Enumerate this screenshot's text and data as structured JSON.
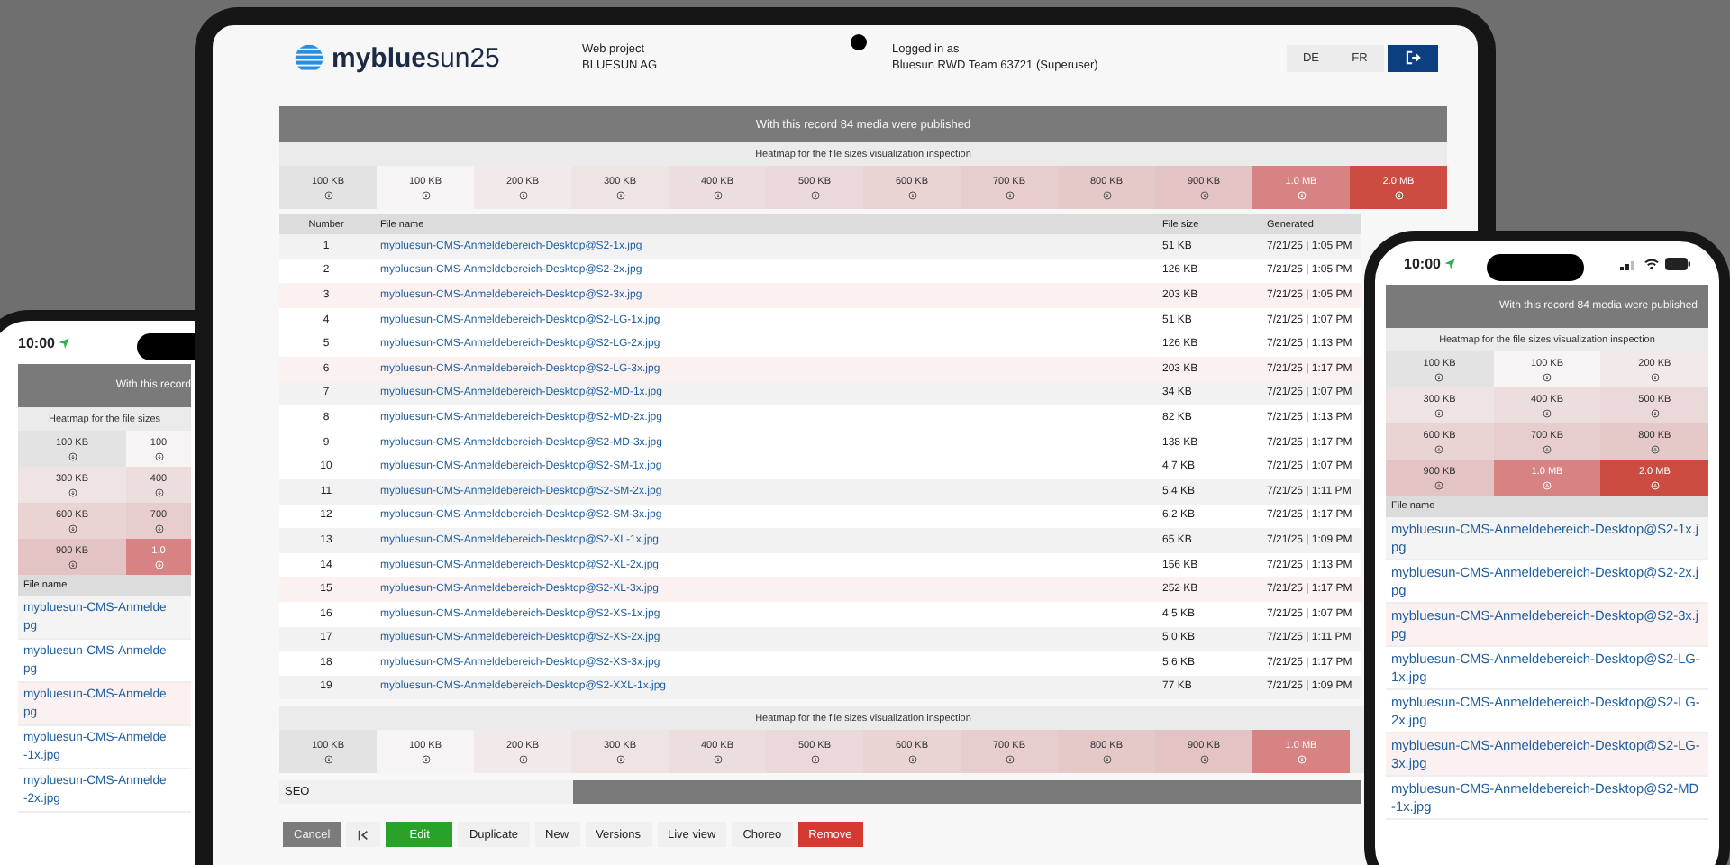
{
  "tablet": {
    "header": {
      "logo": "**myblue**sun25",
      "project_label": "Web project",
      "project": "BLUESUN AG",
      "login_label": "Logged in as",
      "login": "Bluesun RWD Team 63721 (Superuser)",
      "languages": [
        "DE",
        "FR"
      ]
    },
    "banner": "With this record 84 media were published",
    "heatmap": {
      "title": "Heatmap for the file sizes visualization inspection",
      "cells": [
        {
          "label": "100 KB",
          "color": "#e3e3e3"
        },
        {
          "label": "100 KB",
          "color": "#f6f4f4"
        },
        {
          "label": "200 KB",
          "color": "#f2eaea"
        },
        {
          "label": "300 KB",
          "color": "#efe4e4"
        },
        {
          "label": "400 KB",
          "color": "#eddede"
        },
        {
          "label": "500 KB",
          "color": "#ebd9d9"
        },
        {
          "label": "600 KB",
          "color": "#e9d3d3"
        },
        {
          "label": "700 KB",
          "color": "#e7cdcd"
        },
        {
          "label": "800 KB",
          "color": "#e5c8c8"
        },
        {
          "label": "900 KB",
          "color": "#e3c3c3"
        },
        {
          "label": "1.0 MB",
          "color": "#d88383"
        },
        {
          "label": "2.0 MB",
          "color": "#cc4c42"
        }
      ]
    },
    "table": {
      "columns": [
        "Number",
        "File name",
        "File size",
        "Generated"
      ],
      "rows": [
        {
          "number": "1",
          "file": "mybluesun-CMS-Anmeldebereich-Desktop@S2-1x.jpg",
          "size": "51 KB",
          "generated": "7/21/25 | 1:05 PM",
          "color": "#f2f2f2"
        },
        {
          "number": "2",
          "file": "mybluesun-CMS-Anmeldebereich-Desktop@S2-2x.jpg",
          "size": "126 KB",
          "generated": "7/21/25 | 1:05 PM",
          "color": "#ffffff"
        },
        {
          "number": "3",
          "file": "mybluesun-CMS-Anmeldebereich-Desktop@S2-3x.jpg",
          "size": "203 KB",
          "generated": "7/21/25 | 1:05 PM",
          "color": "#fcf1f1"
        },
        {
          "number": "4",
          "file": "mybluesun-CMS-Anmeldebereich-Desktop@S2-LG-1x.jpg",
          "size": "51 KB",
          "generated": "7/21/25 | 1:07 PM",
          "color": "#ffffff"
        },
        {
          "number": "5",
          "file": "mybluesun-CMS-Anmeldebereich-Desktop@S2-LG-2x.jpg",
          "size": "126 KB",
          "generated": "7/21/25 | 1:13 PM",
          "color": "#ffffff"
        },
        {
          "number": "6",
          "file": "mybluesun-CMS-Anmeldebereich-Desktop@S2-LG-3x.jpg",
          "size": "203 KB",
          "generated": "7/21/25 | 1:17 PM",
          "color": "#fcf1f1"
        },
        {
          "number": "7",
          "file": "mybluesun-CMS-Anmeldebereich-Desktop@S2-MD-1x.jpg",
          "size": "34 KB",
          "generated": "7/21/25 | 1:07 PM",
          "color": "#f2f2f2"
        },
        {
          "number": "8",
          "file": "mybluesun-CMS-Anmeldebereich-Desktop@S2-MD-2x.jpg",
          "size": "82 KB",
          "generated": "7/21/25 | 1:13 PM",
          "color": "#ffffff"
        },
        {
          "number": "9",
          "file": "mybluesun-CMS-Anmeldebereich-Desktop@S2-MD-3x.jpg",
          "size": "138 KB",
          "generated": "7/21/25 | 1:17 PM",
          "color": "#ffffff"
        },
        {
          "number": "10",
          "file": "mybluesun-CMS-Anmeldebereich-Desktop@S2-SM-1x.jpg",
          "size": "4.7 KB",
          "generated": "7/21/25 | 1:07 PM",
          "color": "#ffffff"
        },
        {
          "number": "11",
          "file": "mybluesun-CMS-Anmeldebereich-Desktop@S2-SM-2x.jpg",
          "size": "5.4 KB",
          "generated": "7/21/25 | 1:11 PM",
          "color": "#f2f2f2"
        },
        {
          "number": "12",
          "file": "mybluesun-CMS-Anmeldebereich-Desktop@S2-SM-3x.jpg",
          "size": "6.2 KB",
          "generated": "7/21/25 | 1:17 PM",
          "color": "#ffffff"
        },
        {
          "number": "13",
          "file": "mybluesun-CMS-Anmeldebereich-Desktop@S2-XL-1x.jpg",
          "size": "65 KB",
          "generated": "7/21/25 | 1:09 PM",
          "color": "#f2f2f2"
        },
        {
          "number": "14",
          "file": "mybluesun-CMS-Anmeldebereich-Desktop@S2-XL-2x.jpg",
          "size": "156 KB",
          "generated": "7/21/25 | 1:13 PM",
          "color": "#ffffff"
        },
        {
          "number": "15",
          "file": "mybluesun-CMS-Anmeldebereich-Desktop@S2-XL-3x.jpg",
          "size": "252 KB",
          "generated": "7/21/25 | 1:17 PM",
          "color": "#fcf1f1"
        },
        {
          "number": "16",
          "file": "mybluesun-CMS-Anmeldebereich-Desktop@S2-XS-1x.jpg",
          "size": "4.5 KB",
          "generated": "7/21/25 | 1:07 PM",
          "color": "#ffffff"
        },
        {
          "number": "17",
          "file": "mybluesun-CMS-Anmeldebereich-Desktop@S2-XS-2x.jpg",
          "size": "5.0 KB",
          "generated": "7/21/25 | 1:11 PM",
          "color": "#f2f2f2"
        },
        {
          "number": "18",
          "file": "mybluesun-CMS-Anmeldebereich-Desktop@S2-XS-3x.jpg",
          "size": "5.6 KB",
          "generated": "7/21/25 | 1:17 PM",
          "color": "#ffffff"
        },
        {
          "number": "19",
          "file": "mybluesun-CMS-Anmeldebereich-Desktop@S2-XXL-1x.jpg",
          "size": "77 KB",
          "generated": "7/21/25 | 1:09 PM",
          "color": "#f2f2f2"
        }
      ]
    },
    "heatmap_2": {
      "title": "Heatmap for the file sizes visualization inspection",
      "cells": [
        {
          "label": "100 KB",
          "color": "#e3e3e3"
        },
        {
          "label": "100 KB",
          "color": "#f6f4f4"
        },
        {
          "label": "200 KB",
          "color": "#f2eaea"
        },
        {
          "label": "300 KB",
          "color": "#efe4e4"
        },
        {
          "label": "400 KB",
          "color": "#eddede"
        },
        {
          "label": "500 KB",
          "color": "#ebd9d9"
        },
        {
          "label": "600 KB",
          "color": "#e9d3d3"
        },
        {
          "label": "700 KB",
          "color": "#e7cdcd"
        },
        {
          "label": "800 KB",
          "color": "#e5c8c8"
        },
        {
          "label": "900 KB",
          "color": "#e3c3c3"
        },
        {
          "label": "1.0 MB",
          "color": "#d88383"
        }
      ]
    },
    "seo": "SEO",
    "actions": [
      {
        "label": "Cancel",
        "kind": "muted"
      },
      {
        "kind": "icon"
      },
      {
        "label": "Edit",
        "kind": "primary"
      },
      {
        "label": "Duplicate",
        "kind": "plain"
      },
      {
        "label": "New",
        "kind": "plain"
      },
      {
        "label": "Versions",
        "kind": "plain"
      },
      {
        "label": "Live view",
        "kind": "plain"
      },
      {
        "label": "Choreo",
        "kind": "plain"
      },
      {
        "label": "Remove",
        "kind": "danger"
      }
    ]
  },
  "phone_left": {
    "time": "10:00",
    "banner": "With this record",
    "heatmap_title": "Heatmap for the file sizes",
    "cells": [
      {
        "label": "100 KB",
        "color": "#e3e3e3"
      },
      {
        "label": "100",
        "color": "#f6f4f4"
      },
      {
        "label": "300 KB",
        "color": "#efe4e4"
      },
      {
        "label": "400",
        "color": "#eddede"
      },
      {
        "label": "600 KB",
        "color": "#e9d3d3"
      },
      {
        "label": "700",
        "color": "#e7cdcd"
      },
      {
        "label": "900 KB",
        "color": "#e3c3c3"
      },
      {
        "label": "1.0",
        "color": "#d88383"
      }
    ],
    "column": "File name",
    "rows": [
      {
        "lines": [
          "mybluesun-CMS-Anmelde",
          "pg"
        ],
        "color": "#f4f4f4"
      },
      {
        "lines": [
          "mybluesun-CMS-Anmelde",
          "pg"
        ],
        "color": "#ffffff"
      },
      {
        "lines": [
          "mybluesun-CMS-Anmelde",
          "pg"
        ],
        "color": "#fcf1f1"
      },
      {
        "lines": [
          "mybluesun-CMS-Anmelde",
          "-1x.jpg"
        ],
        "color": "#ffffff"
      },
      {
        "lines": [
          "mybluesun-CMS-Anmelde",
          "-2x.jpg"
        ],
        "color": "#ffffff"
      }
    ]
  },
  "phone_right": {
    "time": "10:00",
    "banner": "With this record 84 media were published",
    "heatmap_title": "Heatmap for the file sizes visualization inspection",
    "cells": [
      {
        "label": "100 KB",
        "color": "#e3e3e3"
      },
      {
        "label": "100 KB",
        "color": "#f6f4f4"
      },
      {
        "label": "200 KB",
        "color": "#f2eaea"
      },
      {
        "label": "300 KB",
        "color": "#efe4e4"
      },
      {
        "label": "400 KB",
        "color": "#eddede"
      },
      {
        "label": "500 KB",
        "color": "#ebd9d9"
      },
      {
        "label": "600 KB",
        "color": "#e9d3d3"
      },
      {
        "label": "700 KB",
        "color": "#e7cdcd"
      },
      {
        "label": "800 KB",
        "color": "#e5c8c8"
      },
      {
        "label": "900 KB",
        "color": "#e3c3c3"
      },
      {
        "label": "1.0 MB",
        "color": "#d88383"
      },
      {
        "label": "2.0 MB",
        "color": "#cc4c42"
      }
    ],
    "column": "File name",
    "rows": [
      {
        "file": "mybluesun-CMS-Anmeldebereich-Desktop@S2-1x.jpg",
        "color": "#f4f4f4"
      },
      {
        "file": "mybluesun-CMS-Anmeldebereich-Desktop@S2-2x.jpg",
        "color": "#ffffff"
      },
      {
        "file": "mybluesun-CMS-Anmeldebereich-Desktop@S2-3x.jpg",
        "color": "#fcf1f1"
      },
      {
        "file": "mybluesun-CMS-Anmeldebereich-Desktop@S2-LG-1x.jpg",
        "color": "#ffffff"
      },
      {
        "file": "mybluesun-CMS-Anmeldebereich-Desktop@S2-LG-2x.jpg",
        "color": "#ffffff"
      },
      {
        "file": "mybluesun-CMS-Anmeldebereich-Desktop@S2-LG-3x.jpg",
        "color": "#fcf1f1"
      },
      {
        "file": "mybluesun-CMS-Anmeldebereich-Desktop@S2-MD-1x.jpg",
        "color": "#ffffff"
      }
    ]
  }
}
